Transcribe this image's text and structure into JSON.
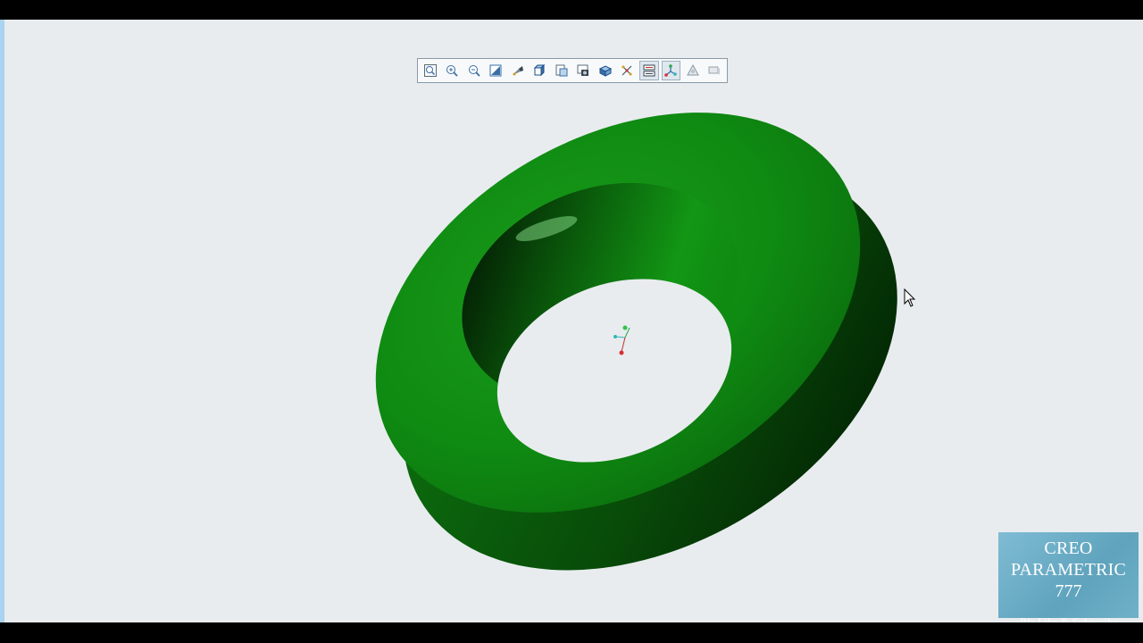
{
  "app": {
    "title": "Creo Parametric"
  },
  "toolbar": {
    "buttons": [
      {
        "name": "refit",
        "icon": "refit-icon",
        "active": false
      },
      {
        "name": "zoom-in",
        "icon": "zoom-in-icon",
        "active": false
      },
      {
        "name": "zoom-out",
        "icon": "zoom-out-icon",
        "active": false
      },
      {
        "name": "repaint",
        "icon": "repaint-icon",
        "active": false
      },
      {
        "name": "perspective",
        "icon": "perspective-icon",
        "active": false
      },
      {
        "name": "display-style",
        "icon": "display-style-icon",
        "active": false
      },
      {
        "name": "saved-orientations",
        "icon": "saved-orientations-icon",
        "active": false
      },
      {
        "name": "view-manager",
        "icon": "view-manager-icon",
        "active": false
      },
      {
        "name": "section",
        "icon": "section-icon",
        "active": false
      },
      {
        "name": "datum-display",
        "icon": "datum-display-icon",
        "active": false
      },
      {
        "name": "annotation-display",
        "icon": "annotation-display-icon",
        "active": true
      },
      {
        "name": "spin-center",
        "icon": "spin-center-icon",
        "active": true
      },
      {
        "name": "simulation",
        "icon": "simulation-icon",
        "active": false
      },
      {
        "name": "flag",
        "icon": "flag-icon",
        "active": false
      }
    ]
  },
  "model": {
    "color": "#0f8a12",
    "shape": "ring-washer"
  },
  "watermark": {
    "title": "CREO PARAMETRIC",
    "number": "777",
    "subtitle": "Plz Like & Subscribe"
  },
  "colors": {
    "background": "#e8ecef",
    "model_green": "#0f8a12",
    "watermark_bg": "#6fb1c8"
  }
}
